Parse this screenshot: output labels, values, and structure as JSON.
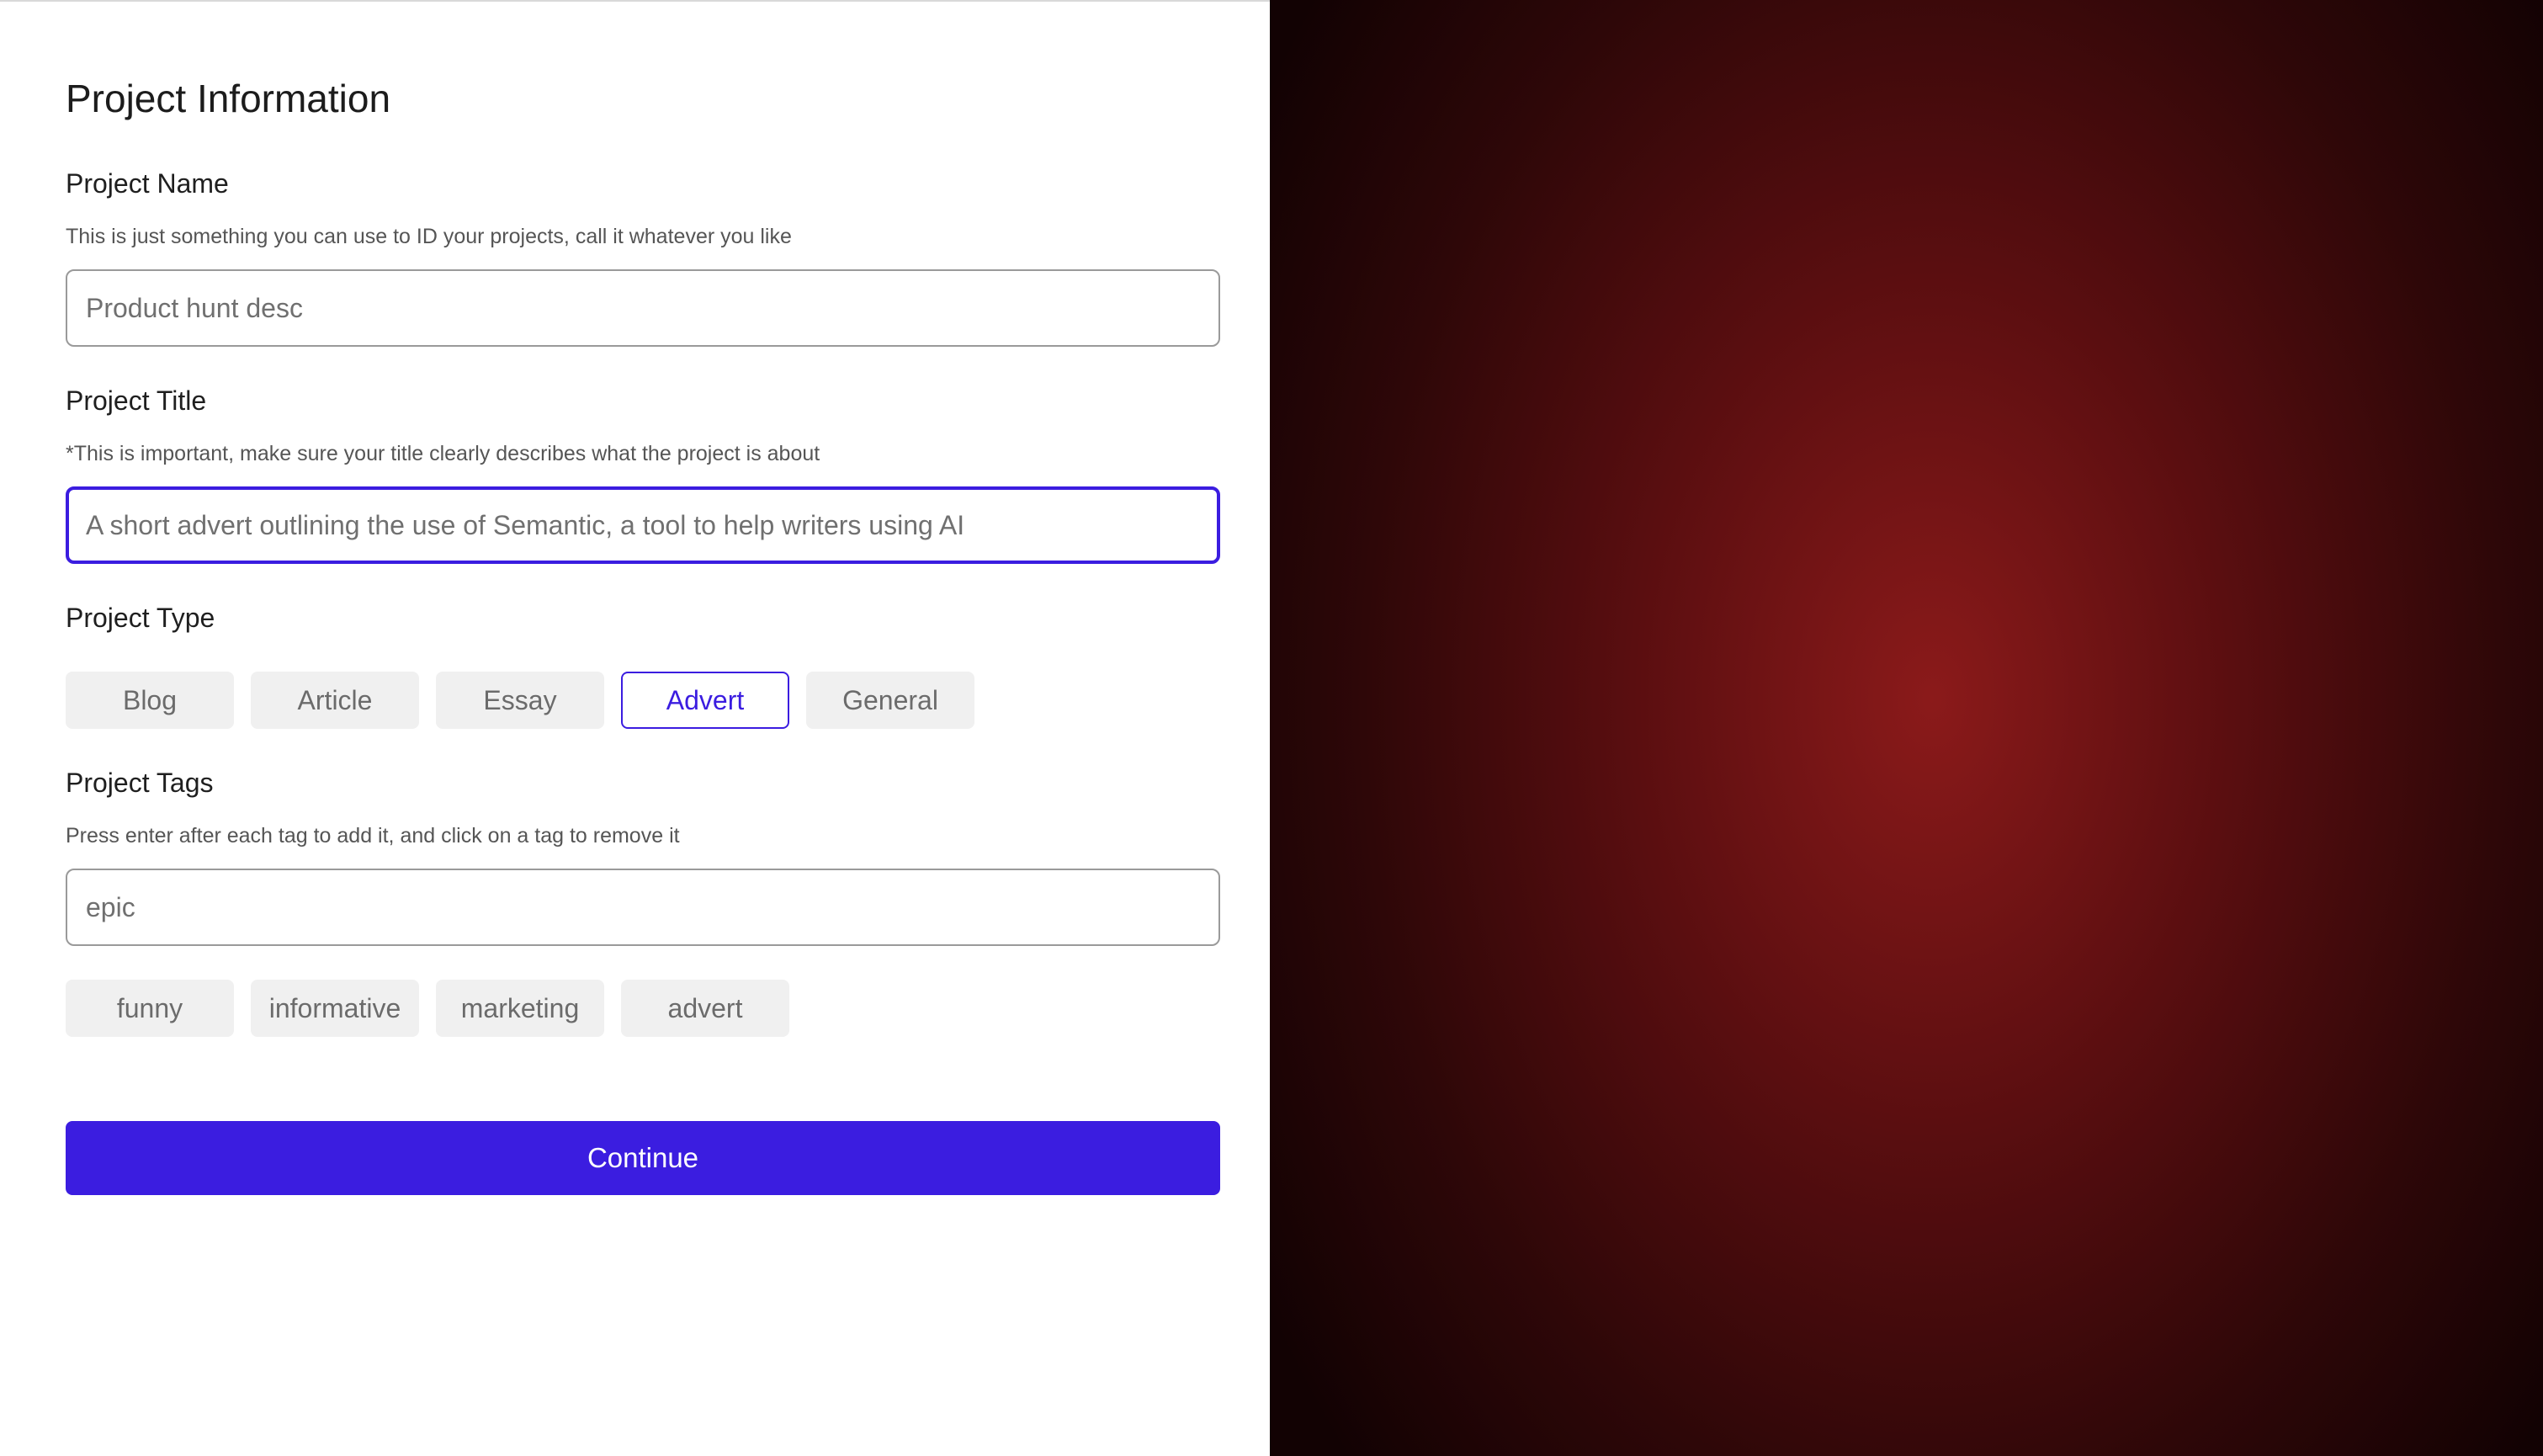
{
  "form": {
    "title": "Project Information",
    "project_name": {
      "label": "Project Name",
      "helper": "This is just something you can use to ID your projects, call it whatever you like",
      "placeholder": "Product hunt desc",
      "value": ""
    },
    "project_title": {
      "label": "Project Title",
      "helper": "*This is important, make sure your title clearly describes what the project is about",
      "placeholder": "A short advert outlining the use of Semantic, a tool to help writers using AI",
      "value": "",
      "focused": true
    },
    "project_type": {
      "label": "Project Type",
      "options": [
        {
          "label": "Blog",
          "selected": false
        },
        {
          "label": "Article",
          "selected": false
        },
        {
          "label": "Essay",
          "selected": false
        },
        {
          "label": "Advert",
          "selected": true
        },
        {
          "label": "General",
          "selected": false
        }
      ]
    },
    "project_tags": {
      "label": "Project Tags",
      "helper": "Press enter after each tag to add it, and click on a tag to remove it",
      "placeholder": "epic",
      "value": "",
      "tags": [
        "funny",
        "informative",
        "marketing",
        "advert"
      ]
    },
    "continue_label": "Continue"
  },
  "colors": {
    "accent": "#3b1de0",
    "chip_bg": "#f0f0f0",
    "art_center": "#8b1a1a",
    "art_edge": "#120203"
  }
}
